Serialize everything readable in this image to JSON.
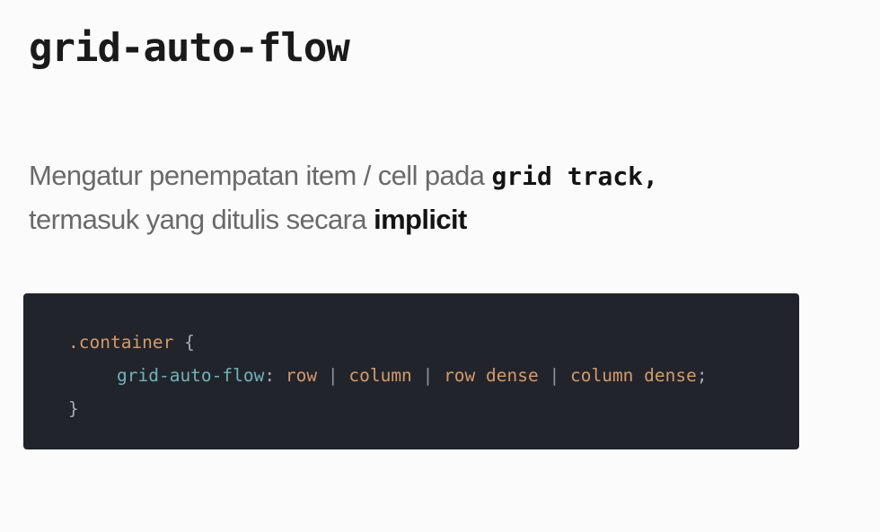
{
  "slide": {
    "title": "grid-auto-flow",
    "description": {
      "line1_text": "Mengatur penempatan item / cell pada ",
      "line1_keyword": "grid track,",
      "line2_text": "termasuk yang ditulis secara ",
      "line2_keyword": "implicit"
    }
  },
  "code": {
    "selector": ".container",
    "open_brace": " {",
    "property": "grid-auto-flow",
    "colon": ":",
    "values": [
      "row",
      "column",
      "row dense",
      "column dense"
    ],
    "separator": "|",
    "semicolon": ";",
    "close_brace": "}"
  },
  "colors": {
    "background": "#fbfbfb",
    "code_background": "#22242c",
    "property": "#6fb3b8",
    "value": "#d39a6a"
  }
}
